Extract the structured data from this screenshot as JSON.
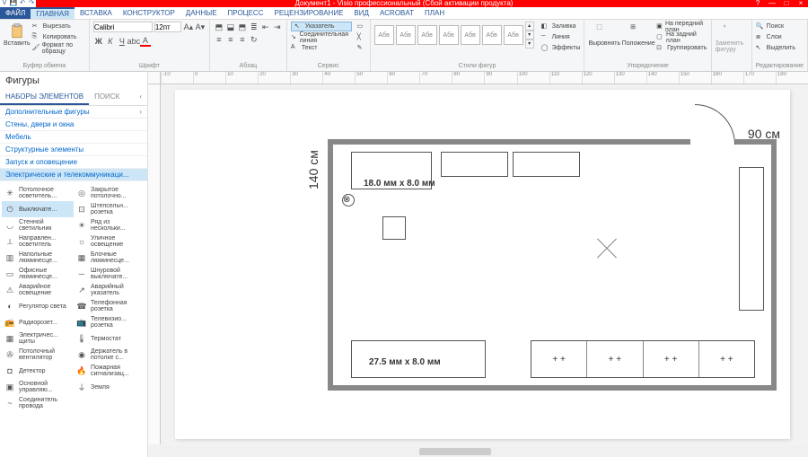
{
  "title": "Документ1 -   Visio профессиональный (Сбой активации продукта)",
  "tabs": {
    "file": "ФАЙЛ",
    "home": "ГЛАВНАЯ",
    "insert": "ВСТАВКА",
    "design": "КОНСТРУКТОР",
    "data": "ДАННЫЕ",
    "process": "ПРОЦЕСС",
    "review": "РЕЦЕНЗИРОВАНИЕ",
    "view": "ВИД",
    "acrobat": "ACROBAT",
    "plan": "ПЛАН"
  },
  "ribbon": {
    "clipboard": {
      "paste": "Вставить",
      "cut": "Вырезать",
      "copy": "Копировать",
      "format": "Формат по образцу",
      "label": "Буфер обмена"
    },
    "font": {
      "name": "Calibri",
      "size": "12пт",
      "label": "Шрифт"
    },
    "paragraph": {
      "label": "Абзац"
    },
    "tools": {
      "pointer": "Указатель",
      "connector": "Соединительная линия",
      "text": "Текст",
      "label": "Сервис"
    },
    "styles": {
      "box": "Aбв",
      "fill": "Заливка",
      "line": "Линия",
      "effects": "Эффекты",
      "label": "Стили фигур"
    },
    "arrange": {
      "align": "Выровнять",
      "position": "Положение",
      "front": "На передний план",
      "back": "На задний план",
      "group": "Группировать",
      "label": "Упорядочение"
    },
    "edit": {
      "change": "Заменить фигуру",
      "find": "Поиск",
      "layers": "Слои",
      "select": "Выделить",
      "label": "Редактирование"
    }
  },
  "shapes": {
    "title": "Фигуры",
    "tab1": "НАБОРЫ ЭЛЕМЕНТОВ",
    "tab2": "ПОИСК",
    "stencils": [
      "Дополнительные фигуры",
      "Стены, двери и окна",
      "Мебель",
      "Структурные элементы",
      "Запуск и оповещение",
      "Электрические и телекоммуникаци..."
    ],
    "grid": [
      [
        "Потолочное осветитель...",
        "Закрытое потолочно..."
      ],
      [
        "Выключате...",
        "Штепсельн... розетка"
      ],
      [
        "Стенной светильник",
        "Ряд из нескольки..."
      ],
      [
        "Направлен... осветитель",
        "Уличное освещение"
      ],
      [
        "Напольные люминесце...",
        "Блочные люминесце..."
      ],
      [
        "Офисные люминесце...",
        "Шнуровой выключате..."
      ],
      [
        "Аварийное освещение",
        "Аварийный указатель"
      ],
      [
        "Регулятор света",
        "Телефонная розетка"
      ],
      [
        "Радиорозет...",
        "Телевизио... розетка"
      ],
      [
        "Электричес... щиты",
        "Термостат"
      ],
      [
        "Потолочный вентилятор",
        "Держатель в потолке с..."
      ],
      [
        "Детектор",
        "Пожарная сигнализац..."
      ],
      [
        "Основной управляю...",
        "Земля"
      ],
      [
        "Соединитель провода",
        ""
      ]
    ]
  },
  "drawing": {
    "dim_v": "140 см",
    "dim_h": "90 см",
    "label1": "18.0 мм x 8.0 мм",
    "label2": "27.5 мм x 8.0 мм"
  },
  "ruler_h": [
    "-10",
    "0",
    "10",
    "20",
    "30",
    "40",
    "50",
    "60",
    "70",
    "80",
    "90",
    "100",
    "110",
    "120",
    "130",
    "140",
    "150",
    "160",
    "170",
    "180"
  ]
}
